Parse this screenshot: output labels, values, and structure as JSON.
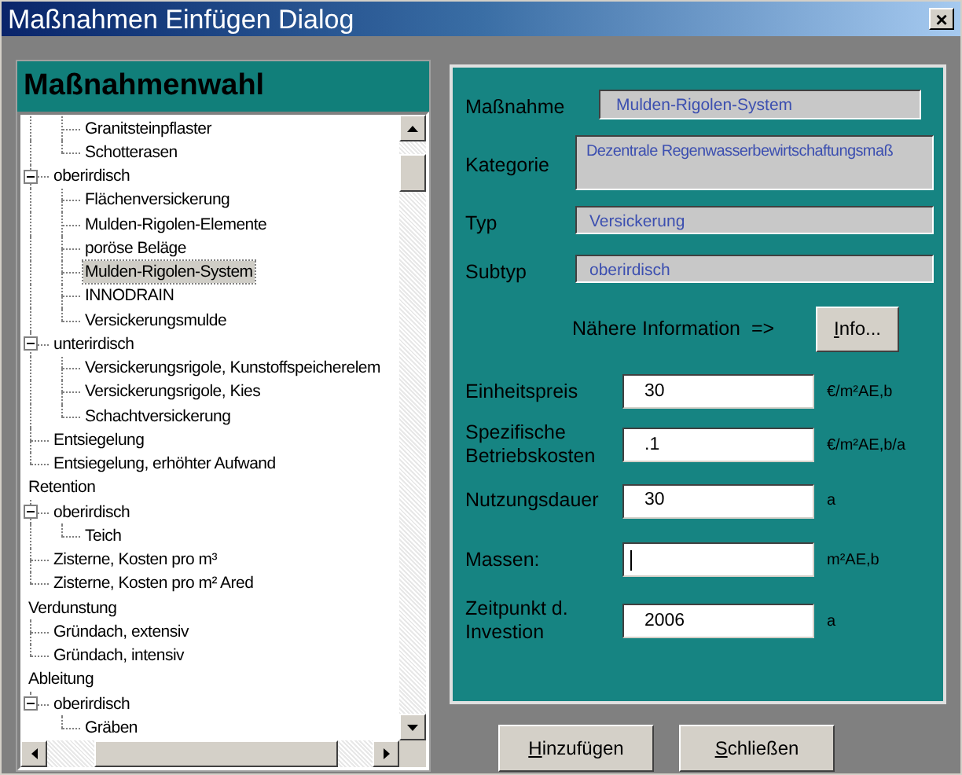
{
  "window": {
    "title": "Maßnahmen Einfügen Dialog",
    "close": "×"
  },
  "tree_panel": {
    "title": "Maßnahmenwahl",
    "items": [
      {
        "children": [
          {
            "children": [
              {
                "label": "Granitsteinpflaster",
                "selected": false
              },
              {
                "label": "Schotterasen",
                "selected": false
              }
            ]
          },
          {
            "label": "oberirdisch",
            "expanded": true,
            "selected": false,
            "children": [
              {
                "label": "Flächenversickerung",
                "selected": false
              },
              {
                "label": "Mulden-Rigolen-Elemente",
                "selected": false
              },
              {
                "label": "poröse Beläge",
                "selected": false
              },
              {
                "label": "Mulden-Rigolen-System",
                "selected": true
              },
              {
                "label": "INNODRAIN",
                "selected": false
              },
              {
                "label": "Versickerungsmulde",
                "selected": false
              }
            ]
          },
          {
            "label": "unterirdisch",
            "expanded": true,
            "selected": false,
            "children": [
              {
                "label": "Versickerungsrigole, Kunstoffspeicherelem",
                "selected": false
              },
              {
                "label": "Versickerungsrigole, Kies",
                "selected": false
              },
              {
                "label": "Schachtversickerung",
                "selected": false
              }
            ]
          },
          {
            "label": "Entsiegelung",
            "selected": false
          },
          {
            "label": "Entsiegelung, erhöhter Aufwand",
            "selected": false
          }
        ]
      },
      {
        "label": "Retention",
        "selected": false,
        "children": [
          {
            "label": "oberirdisch",
            "expanded": true,
            "selected": false,
            "children": [
              {
                "label": "Teich",
                "selected": false
              }
            ]
          },
          {
            "label": "Zisterne, Kosten pro m³",
            "selected": false
          },
          {
            "label": "Zisterne, Kosten pro m² Ared",
            "selected": false
          }
        ]
      },
      {
        "label": "Verdunstung",
        "selected": false,
        "children": [
          {
            "label": "Gründach, extensiv",
            "selected": false
          },
          {
            "label": "Gründach, intensiv",
            "selected": false
          }
        ]
      },
      {
        "label": "Ableitung",
        "selected": false,
        "children": [
          {
            "label": "oberirdisch",
            "expanded": true,
            "selected": false,
            "children": [
              {
                "label": "Gräben",
                "selected": false
              }
            ]
          }
        ]
      }
    ]
  },
  "info_fields": [
    {
      "label": "Maßnahme",
      "value": "Mulden-Rigolen-System",
      "kind": "wide"
    },
    {
      "label": "Kategorie",
      "value": "Dezentrale Regenwasserbewirtschaftungsmaß",
      "kind": "tall"
    },
    {
      "label": "Typ",
      "value": "Versickerung",
      "kind": "normal"
    },
    {
      "label": "Subtyp",
      "value": "oberirdisch",
      "kind": "normal"
    }
  ],
  "more_info": {
    "label": "Nähere Information  =>",
    "button": "Info..."
  },
  "inputs": [
    {
      "label": "Einheitspreis",
      "value": "30",
      "unit": "€/m²AE,b",
      "focused": false
    },
    {
      "label": "Spezifische Betriebskosten",
      "value": ".1",
      "unit": "€/m²AE,b/a",
      "focused": false
    },
    {
      "label": "Nutzungsdauer",
      "value": "30",
      "unit": "a",
      "focused": false
    },
    {
      "label": "Massen:",
      "unit": "m²AE,b",
      "focused": true
    },
    {
      "label": "Zeitpunkt d. Investion",
      "value": "2006",
      "unit": "a",
      "focused": false
    }
  ],
  "buttons": [
    "Hinzufügen",
    "Schließen"
  ]
}
